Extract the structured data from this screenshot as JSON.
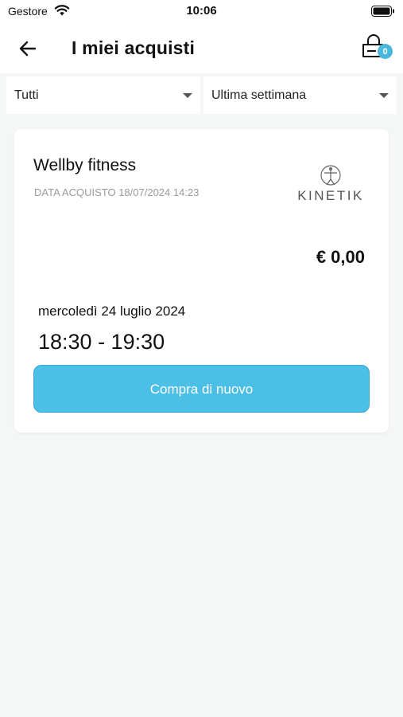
{
  "status_bar": {
    "carrier": "Gestore",
    "time": "10:06"
  },
  "header": {
    "title": "I miei acquisti",
    "cart_count": "0"
  },
  "filters": {
    "type_selected": "Tutti",
    "period_selected": "Ultima settimana"
  },
  "purchase": {
    "title": "Wellby fitness",
    "purchase_date": "DATA ACQUISTO 18/07/2024 14:23",
    "logo_text": "KINETIK",
    "price": "€ 0,00",
    "slot_date": "mercoledì 24 luglio 2024",
    "slot_time": "18:30 - 19:30",
    "buy_again_label": "Compra di nuovo"
  },
  "colors": {
    "accent": "#4bbfe6",
    "badge": "#4ab8dd",
    "background": "#f5f6f6"
  }
}
